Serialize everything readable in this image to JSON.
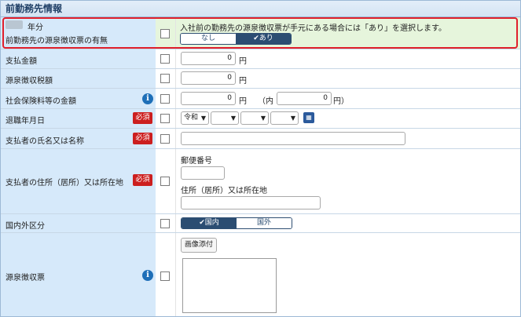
{
  "section_title": "前勤務先情報",
  "rows": {
    "prev_employer": {
      "year_suffix": "年分",
      "label": "前勤務先の源泉徴収票の有無",
      "hint": "入社前の勤務先の源泉徴収票が手元にある場合には「あり」を選択します。",
      "options": [
        "なし",
        "✔あり"
      ]
    },
    "payment": {
      "label": "支払金額",
      "value": "0",
      "unit": "円"
    },
    "withholding": {
      "label": "源泉徴収税額",
      "value": "0",
      "unit": "円"
    },
    "social_insurance": {
      "label": "社会保険料等の金額",
      "value": "0",
      "unit": "円",
      "inner_prefix": "（内",
      "inner_value": "0",
      "inner_unit": "円）"
    },
    "retire_date": {
      "label": "退職年月日",
      "required": "必須",
      "era": "令和"
    },
    "payer_name": {
      "label": "支払者の氏名又は名称",
      "required": "必須"
    },
    "payer_address": {
      "label": "支払者の住所（居所）又は所在地",
      "required": "必須",
      "postal_label": "郵便番号",
      "address_label": "住所（居所）又は所在地"
    },
    "domestic": {
      "label": "国内外区分",
      "options": [
        "✔国内",
        "国外"
      ]
    },
    "slip": {
      "label": "源泉徴収票",
      "attach_button": "画像添付"
    }
  },
  "icons": {
    "info": "info-icon",
    "calendar": "calendar-icon"
  },
  "colors": {
    "label_bg": "#d6e9fa",
    "highlight": "#e0202c",
    "required": "#cc1f1f",
    "toggle": "#2b4d72"
  }
}
